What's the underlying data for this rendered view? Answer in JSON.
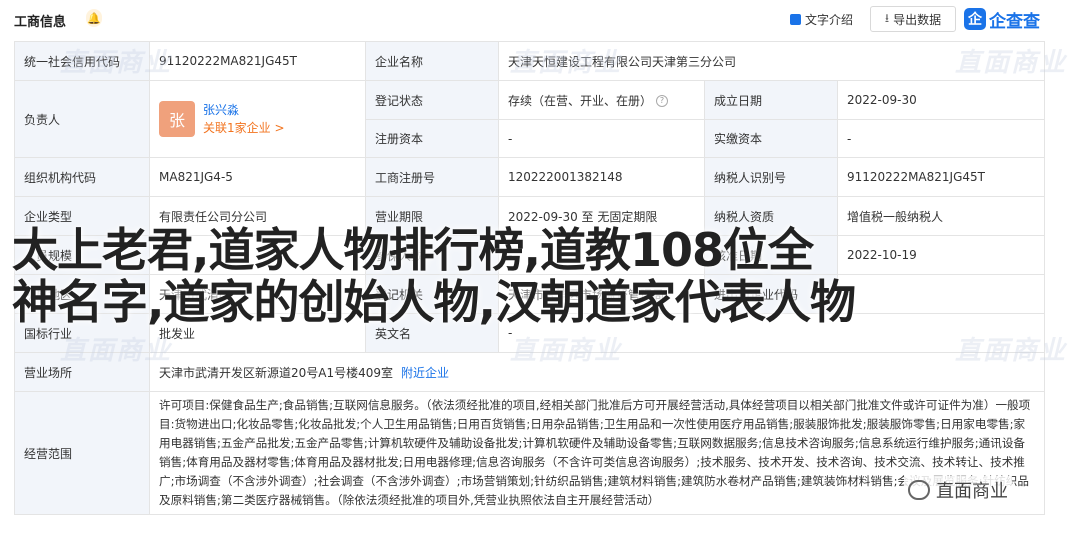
{
  "header": {
    "title": "工商信息",
    "intro_label": "文字介绍",
    "export_label": "导出数据",
    "logo_mark": "企",
    "logo_text": "企查查"
  },
  "rows": {
    "credit_code_label": "统一社会信用代码",
    "credit_code_value": "91120222MA821JG45T",
    "company_name_label": "企业名称",
    "company_name_value": "天津天恒建设工程有限公司天津第三分公司",
    "legal_rep_label": "负责人",
    "legal_rep_avatar": "张",
    "legal_rep_name": "张兴淼",
    "legal_rep_link": "关联1家企业 >",
    "reg_status_label": "登记状态",
    "reg_status_value": "存续（在营、开业、在册）",
    "found_date_label": "成立日期",
    "found_date_value": "2022-09-30",
    "reg_capital_label": "注册资本",
    "reg_capital_value": "-",
    "paid_capital_label": "实缴资本",
    "paid_capital_value": "-",
    "org_code_label": "组织机构代码",
    "org_code_value": "MA821JG4-5",
    "biz_reg_no_label": "工商注册号",
    "biz_reg_no_value": "120222001382148",
    "taxpayer_id_label": "纳税人识别号",
    "taxpayer_id_value": "91120222MA821JG45T",
    "ent_type_label": "企业类型",
    "ent_type_value": "有限责任公司分公司",
    "biz_term_label": "营业期限",
    "biz_term_value": "2022-09-30 至 无固定期限",
    "taxpayer_qual_label": "纳税人资质",
    "taxpayer_qual_value": "增值税一般纳税人",
    "staff_size_label": "人员规模",
    "staff_size_value": "-",
    "insured_label": "参保人数",
    "insured_value": "-",
    "approve_date_label": "核准日期",
    "approve_date_value": "2022-10-19",
    "region_label": "所属地区",
    "region_value": "天津市武清区",
    "authority_label": "登记机关",
    "authority_value": "天津市武清区市场监督管理局",
    "import_code_label": "进出口企业代码",
    "import_code_value": "-",
    "industry_label": "国标行业",
    "industry_value": "批发业",
    "en_name_label": "英文名",
    "en_name_value": "-",
    "address_label": "营业场所",
    "address_value": "天津市武清开发区新源道20号A1号楼409室",
    "address_link": "附近企业",
    "scope_label": "经营范围",
    "scope_value": "许可项目:保健食品生产;食品销售;互联网信息服务。（依法须经批准的项目,经相关部门批准后方可开展经营活动,具体经营项目以相关部门批准文件或许可证件为准）一般项目:货物进出口;化妆品零售;化妆品批发;个人卫生用品销售;日用百货销售;日用杂品销售;卫生用品和一次性使用医疗用品销售;服装服饰批发;服装服饰零售;日用家电零售;家用电器销售;五金产品批发;五金产品零售;计算机软硬件及辅助设备批发;计算机软硬件及辅助设备零售;互联网数据服务;信息技术咨询服务;信息系统运行维护服务;通讯设备销售;体育用品及器材零售;体育用品及器材批发;日用电器修理;信息咨询服务（不含许可类信息咨询服务）;技术服务、技术开发、技术咨询、技术交流、技术转让、技术推广;市场调查（不含涉外调查）;社会调查（不含涉外调查）;市场营销策划;针纺织品销售;建筑材料销售;建筑防水卷材产品销售;建筑装饰材料销售;会议及展览服务;针纺织品及原料销售;第二类医疗器械销售。（除依法须经批准的项目外,凭营业执照依法自主开展经营活动）"
  },
  "overlay": {
    "line1": "太上老君,道家人物排行榜,道教108位全",
    "line2": "神名字,道家的创始人物,汉朝道家代表人物"
  },
  "watermark": {
    "text": "直面商业"
  },
  "badge": {
    "text": "直面商业"
  }
}
